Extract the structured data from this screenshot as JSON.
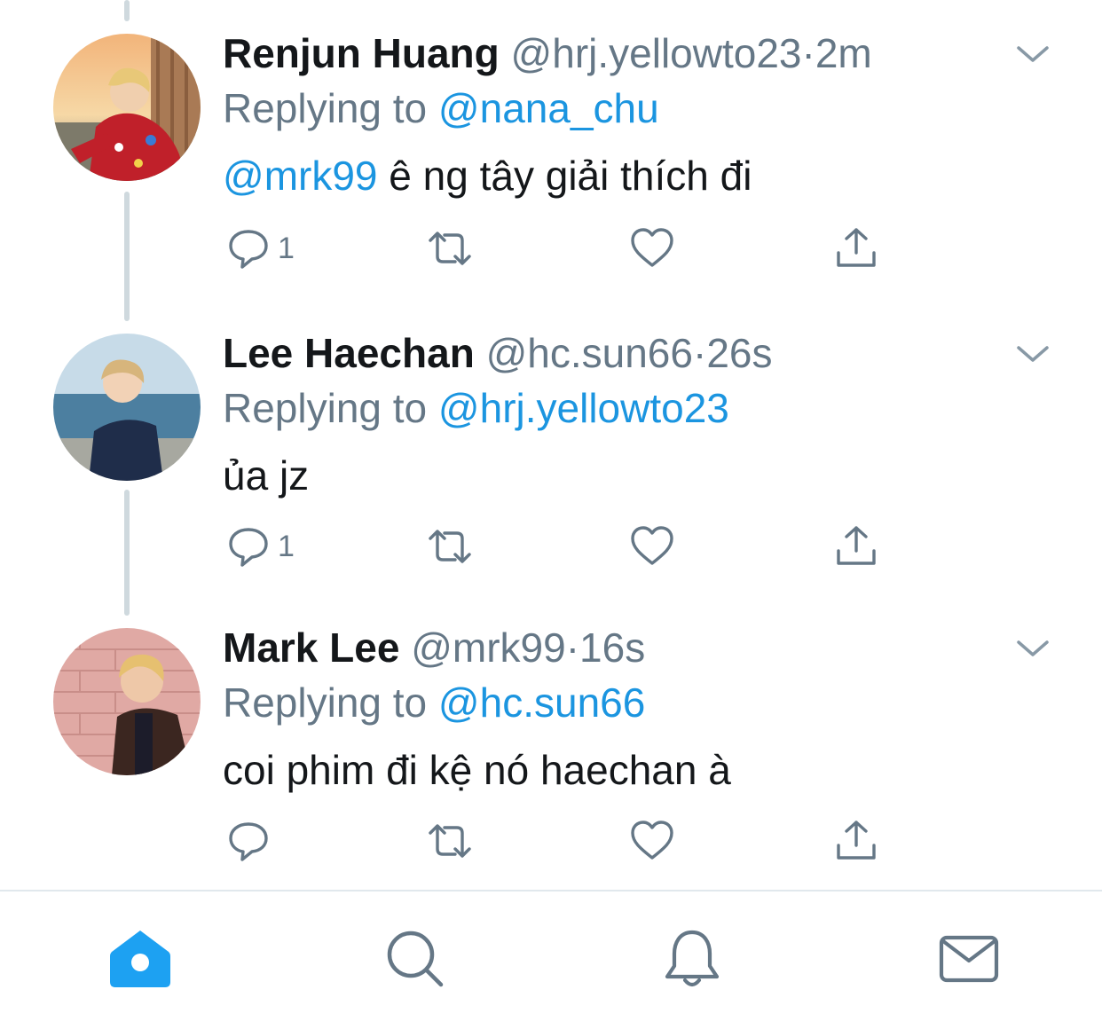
{
  "timeline": {
    "tweets": [
      {
        "name": "Renjun Huang",
        "handle": "@hrj.yellowto23",
        "dot": "·",
        "time": "2m",
        "replying_prefix": "Replying to",
        "replying_to": "@nana_chu",
        "mention": "@mrk99",
        "text": " ê ng tây giải thích đi",
        "reply_count": "1"
      },
      {
        "name": "Lee Haechan",
        "handle": "@hc.sun66",
        "dot": "·",
        "time": "26s",
        "replying_prefix": "Replying to",
        "replying_to": "@hrj.yellowto23",
        "mention": "",
        "text": "ủa jz",
        "reply_count": "1"
      },
      {
        "name": "Mark Lee",
        "handle": "@mrk99",
        "dot": "·",
        "time": "16s",
        "replying_prefix": "Replying to",
        "replying_to": "@hc.sun66",
        "mention": "",
        "text": "coi phim đi kệ nó haechan à",
        "reply_count": ""
      }
    ]
  },
  "tabbar": {
    "tabs": [
      {
        "icon": "home-icon",
        "active": true
      },
      {
        "icon": "search-icon",
        "active": false
      },
      {
        "icon": "bell-icon",
        "active": false
      },
      {
        "icon": "mail-icon",
        "active": false
      }
    ]
  },
  "colors": {
    "accent": "#1da1f2",
    "link": "#1b95e0",
    "muted": "#657786",
    "icon": "#657786",
    "thread_line": "#cfd9de"
  }
}
